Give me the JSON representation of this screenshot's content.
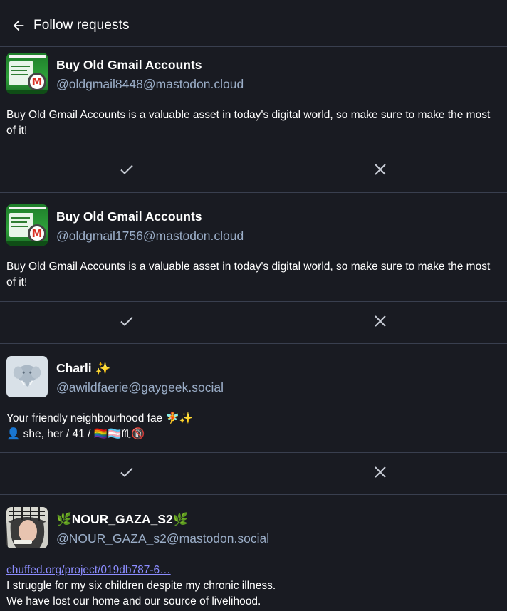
{
  "header": {
    "title": "Follow requests",
    "back_icon": "arrow-left-icon"
  },
  "requests": [
    {
      "display_name": "Buy Old Gmail Accounts",
      "acct": "@oldgmail8448@mastodon.cloud",
      "bio_lines": [
        "Buy Old Gmail Accounts is a valuable asset in today's digital world, so make sure to make the most of it!"
      ],
      "avatar_text": "BUY OLD GMAIL ACCOUNTS"
    },
    {
      "display_name": "Buy Old Gmail Accounts",
      "acct": "@oldgmail1756@mastodon.cloud",
      "bio_lines": [
        "Buy Old Gmail Accounts is a valuable asset in today's digital world, so make sure to make the most of it!"
      ],
      "avatar_text": "BUY OLD GMAIL ACCOUNTS"
    },
    {
      "display_name": "Charli ✨",
      "acct": "@awildfaerie@gaygeek.social",
      "bio_lines": [
        "Your friendly neighbourhood fae 🧚✨",
        "👤 she, her / 41 / 🏳️‍🌈🏳️‍⚧️♏🔞"
      ]
    },
    {
      "display_name": "🌿NOUR_GAZA_S2🌿",
      "acct": "@NOUR_GAZA_s2@mastodon.social",
      "bio_link": "chuffed.org/project/019db787-6…",
      "bio_lines": [
        "I struggle for my six children despite my chronic illness.",
        "We have lost our home and our source of livelihood."
      ]
    }
  ],
  "actions": {
    "authorize_icon": "check-icon",
    "reject_icon": "close-icon"
  },
  "colors": {
    "background": "#191b22",
    "border": "#393f4f",
    "secondary_text": "#9baec8",
    "link": "#8c8dff"
  }
}
